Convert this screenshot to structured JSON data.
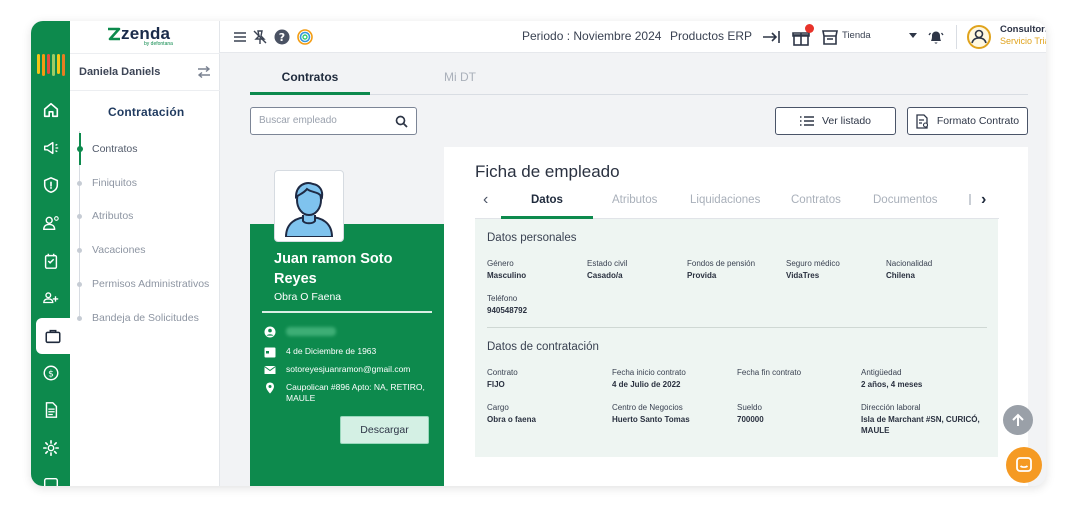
{
  "brand": {
    "name": "zenda",
    "tagline": "by defontana"
  },
  "sidebar": {
    "user_name": "Daniela Daniels",
    "section_title": "Contratación",
    "items": [
      {
        "label": "Contratos"
      },
      {
        "label": "Finiquitos"
      },
      {
        "label": "Atributos"
      },
      {
        "label": "Vacaciones"
      },
      {
        "label": "Permisos Administrativos"
      },
      {
        "label": "Bandeja de Solicitudes"
      }
    ]
  },
  "topbar": {
    "period": "Periodo : Noviembre 2024",
    "products": "Productos ERP",
    "store": "Tienda",
    "account_name": "Consultoria",
    "account_plan": "Servicio Trial"
  },
  "tabs": {
    "contratos": "Contratos",
    "mi_dt": "Mi DT"
  },
  "search": {
    "placeholder": "Buscar empleado"
  },
  "buttons": {
    "ver_listado": "Ver listado",
    "formato_contrato": "Formato Contrato",
    "descargar": "Descargar"
  },
  "employee": {
    "name": "Juan ramon Soto Reyes",
    "role": "Obra O Faena",
    "birth_date": "4 de Diciembre de 1963",
    "email": "sotoreyesjuanramon@gmail.com",
    "address": "Caupolican #896 Apto: NA, RETIRO, MAULE"
  },
  "ficha": {
    "title": "Ficha de empleado",
    "tabs": [
      "Datos",
      "Atributos",
      "Liquidaciones",
      "Contratos",
      "Documentos"
    ],
    "personal_title": "Datos personales",
    "personal": [
      {
        "k": "Género",
        "v": "Masculino"
      },
      {
        "k": "Estado civil",
        "v": "Casado/a"
      },
      {
        "k": "Fondos de pensión",
        "v": "Provida"
      },
      {
        "k": "Seguro médico",
        "v": "VidaTres"
      },
      {
        "k": "Nacionalidad",
        "v": "Chilena"
      },
      {
        "k": "Teléfono",
        "v": "940548792"
      }
    ],
    "contract_title": "Datos de contratación",
    "contract": [
      {
        "k": "Contrato",
        "v": "FIJO"
      },
      {
        "k": "Fecha inicio contrato",
        "v": "4 de Julio de 2022"
      },
      {
        "k": "Fecha fin contrato",
        "v": ""
      },
      {
        "k": "Antigüedad",
        "v": "2 años, 4 meses"
      },
      {
        "k": "Cargo",
        "v": "Obra o faena"
      },
      {
        "k": "Centro de Negocios",
        "v": "Huerto Santo Tomas"
      },
      {
        "k": "Sueldo",
        "v": "700000"
      },
      {
        "k": "Dirección laboral",
        "v": "Isla de Marchant #SN, CURICÓ, MAULE"
      }
    ]
  },
  "colors": {
    "primary": "#0d8a4d",
    "accent": "#f59a23",
    "trial": "#e0a31c"
  }
}
